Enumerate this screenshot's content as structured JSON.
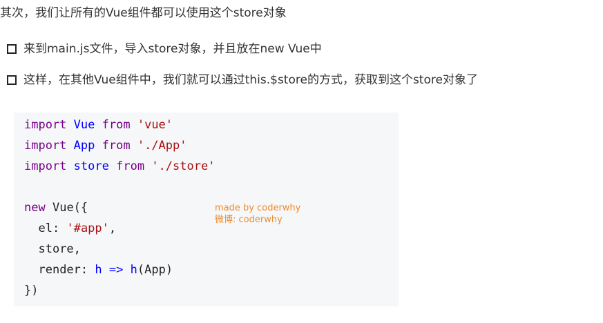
{
  "intro": "其次，我们让所有的Vue组件都可以使用这个store对象",
  "bullets": [
    "来到main.js文件，导入store对象，并且放在new Vue中",
    "这样，在其他Vue组件中，我们就可以通过this.$store的方式，获取到这个store对象了"
  ],
  "code": {
    "line1": {
      "kw": "import",
      "id": "Vue",
      "from": "from",
      "str": "'vue'"
    },
    "line2": {
      "kw": "import",
      "id": "App",
      "from": "from",
      "str": "'./App'"
    },
    "line3": {
      "kw": "import",
      "id": "store",
      "from": "from",
      "str": "'./store'"
    },
    "line5": {
      "kw": "new",
      "rest": "Vue({"
    },
    "line6": {
      "key": "el",
      "colon": ":",
      "str": "'#app'",
      "comma": ","
    },
    "line7": {
      "text": "store,"
    },
    "line8": {
      "key": "render",
      "colon": ":",
      "param": "h",
      "arrow": "=>",
      "fn": "h",
      "args": "(App)"
    },
    "line9": {
      "text": "})"
    }
  },
  "watermark": {
    "line1": "made by coderwhy",
    "line2": "微博: coderwhy"
  },
  "colors": {
    "keyword": "#770088",
    "identifier": "#0000ff",
    "string": "#aa1111",
    "watermark": "#f08a2a",
    "code_background": "#f6f7f9"
  }
}
